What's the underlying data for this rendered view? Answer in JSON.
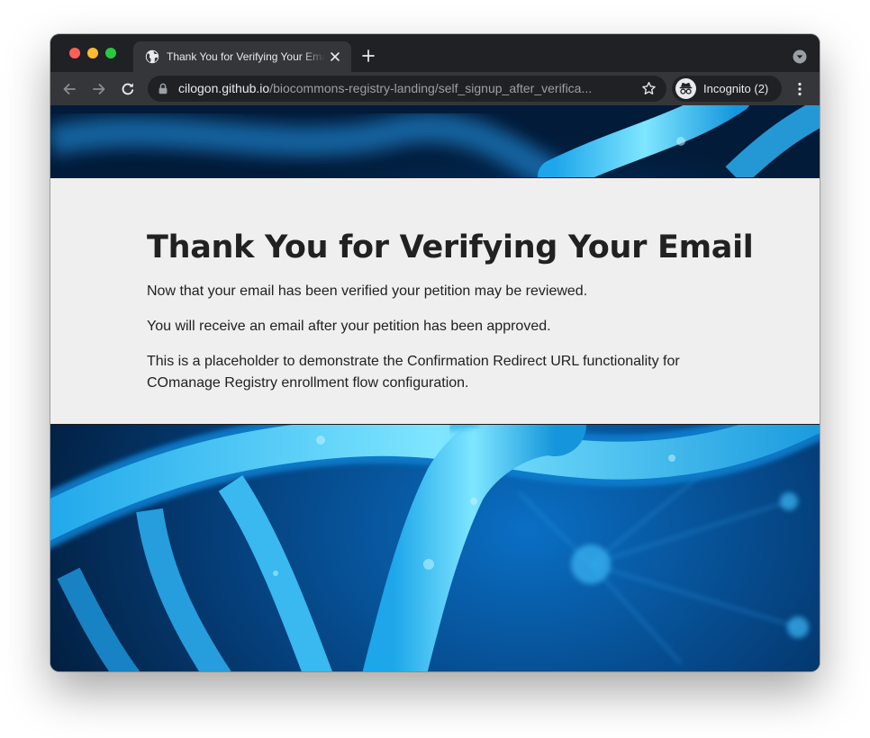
{
  "browser": {
    "tab": {
      "title": "Thank You for Verifying Your Email",
      "favicon": "globe-icon",
      "close_icon": "close-icon"
    },
    "new_tab_icon": "plus-icon",
    "tab_search_icon": "chevron-down-icon",
    "toolbar": {
      "back_icon": "arrow-back-icon",
      "forward_icon": "arrow-forward-icon",
      "reload_icon": "reload-icon",
      "lock_icon": "lock-icon",
      "url_host": "cilogon.github.io",
      "url_path": "/biocommons-registry-landing/self_signup_after_verifica...",
      "bookmark_icon": "star-icon",
      "incognito_label": "Incognito (2)",
      "incognito_icon": "incognito-icon",
      "menu_icon": "kebab-menu-icon"
    },
    "colors": {
      "frame": "#202124",
      "toolbar": "#35363a",
      "close": "#ff5f57",
      "minimize": "#febc2e",
      "zoom": "#28c840"
    }
  },
  "page": {
    "heading": "Thank You for Verifying Your Email",
    "paragraphs": [
      "Now that your email has been verified your petition may be reviewed.",
      "You will receive an email after your petition has been approved.",
      "This is a placeholder to demonstrate the Confirmation Redirect URL functionality for COmanage Registry enrollment flow configuration."
    ],
    "colors": {
      "content_background": "#efefef",
      "text": "#212121",
      "banner_dark": "#04264a",
      "banner_highlight": "#4fd3ff"
    }
  }
}
